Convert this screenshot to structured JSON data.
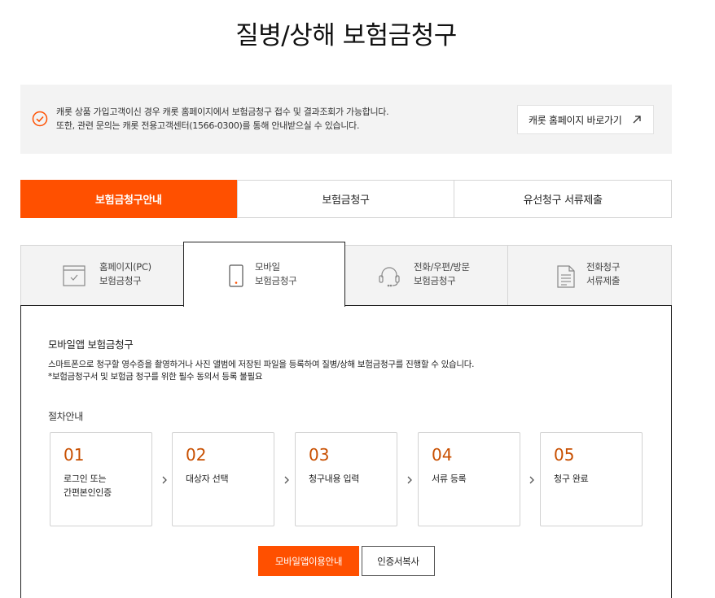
{
  "page": {
    "title": "질병/상해 보험금청구"
  },
  "notice": {
    "line1": "캐롯 상품 가입고객이신 경우 캐롯 홈페이지에서 보험금청구 접수 및 결과조회가 가능합니다.",
    "line2": "또한, 관련 문의는 캐롯 전용고객센터(1566-0300)를 통해 안내받으실 수 있습니다.",
    "link_label": "캐롯 홈페이지 바로가기",
    "icon": "check-circle-icon",
    "link_icon": "arrow-up-right-icon"
  },
  "main_tabs": [
    {
      "label": "보험금청구안내",
      "active": true
    },
    {
      "label": "보험금청구",
      "active": false
    },
    {
      "label": "유선청구 서류제출",
      "active": false
    }
  ],
  "sub_tabs": [
    {
      "line1": "홈페이지(PC)",
      "line2": "보험금청구",
      "icon": "monitor-icon",
      "active": false
    },
    {
      "line1": "모바일",
      "line2": "보험금청구",
      "icon": "smartphone-icon",
      "active": true
    },
    {
      "line1": "전화/우편/방문",
      "line2": "보험금청구",
      "icon": "headset-icon",
      "active": false
    },
    {
      "line1": "전화청구",
      "line2": "서류제출",
      "icon": "document-icon",
      "active": false
    }
  ],
  "panel": {
    "title": "모바일앱 보험금청구",
    "desc1": "스마트폰으로 청구할 영수증을 촬영하거나 사진 앨범에 저장된 파일을 등록하여 질병/상해 보험금청구를 진행할 수 있습니다.",
    "desc2": "*보험금청구서 및 보험금 청구를 위한 필수 동의서 등록 불필요",
    "steps_title": "절차안내",
    "steps": [
      {
        "num": "01",
        "line1": "로그인 또는",
        "line2": "간편본인인증"
      },
      {
        "num": "02",
        "line1": "대상자 선택",
        "line2": ""
      },
      {
        "num": "03",
        "line1": "청구내용 입력",
        "line2": ""
      },
      {
        "num": "04",
        "line1": "서류 등록",
        "line2": ""
      },
      {
        "num": "05",
        "line1": "청구 완료",
        "line2": ""
      }
    ],
    "primary_button": "모바일앱이용안내",
    "secondary_button": "인증서복사"
  },
  "colors": {
    "accent": "#ff5000",
    "step_number": "#c84f00",
    "notice_bg": "#f3f3f3"
  }
}
